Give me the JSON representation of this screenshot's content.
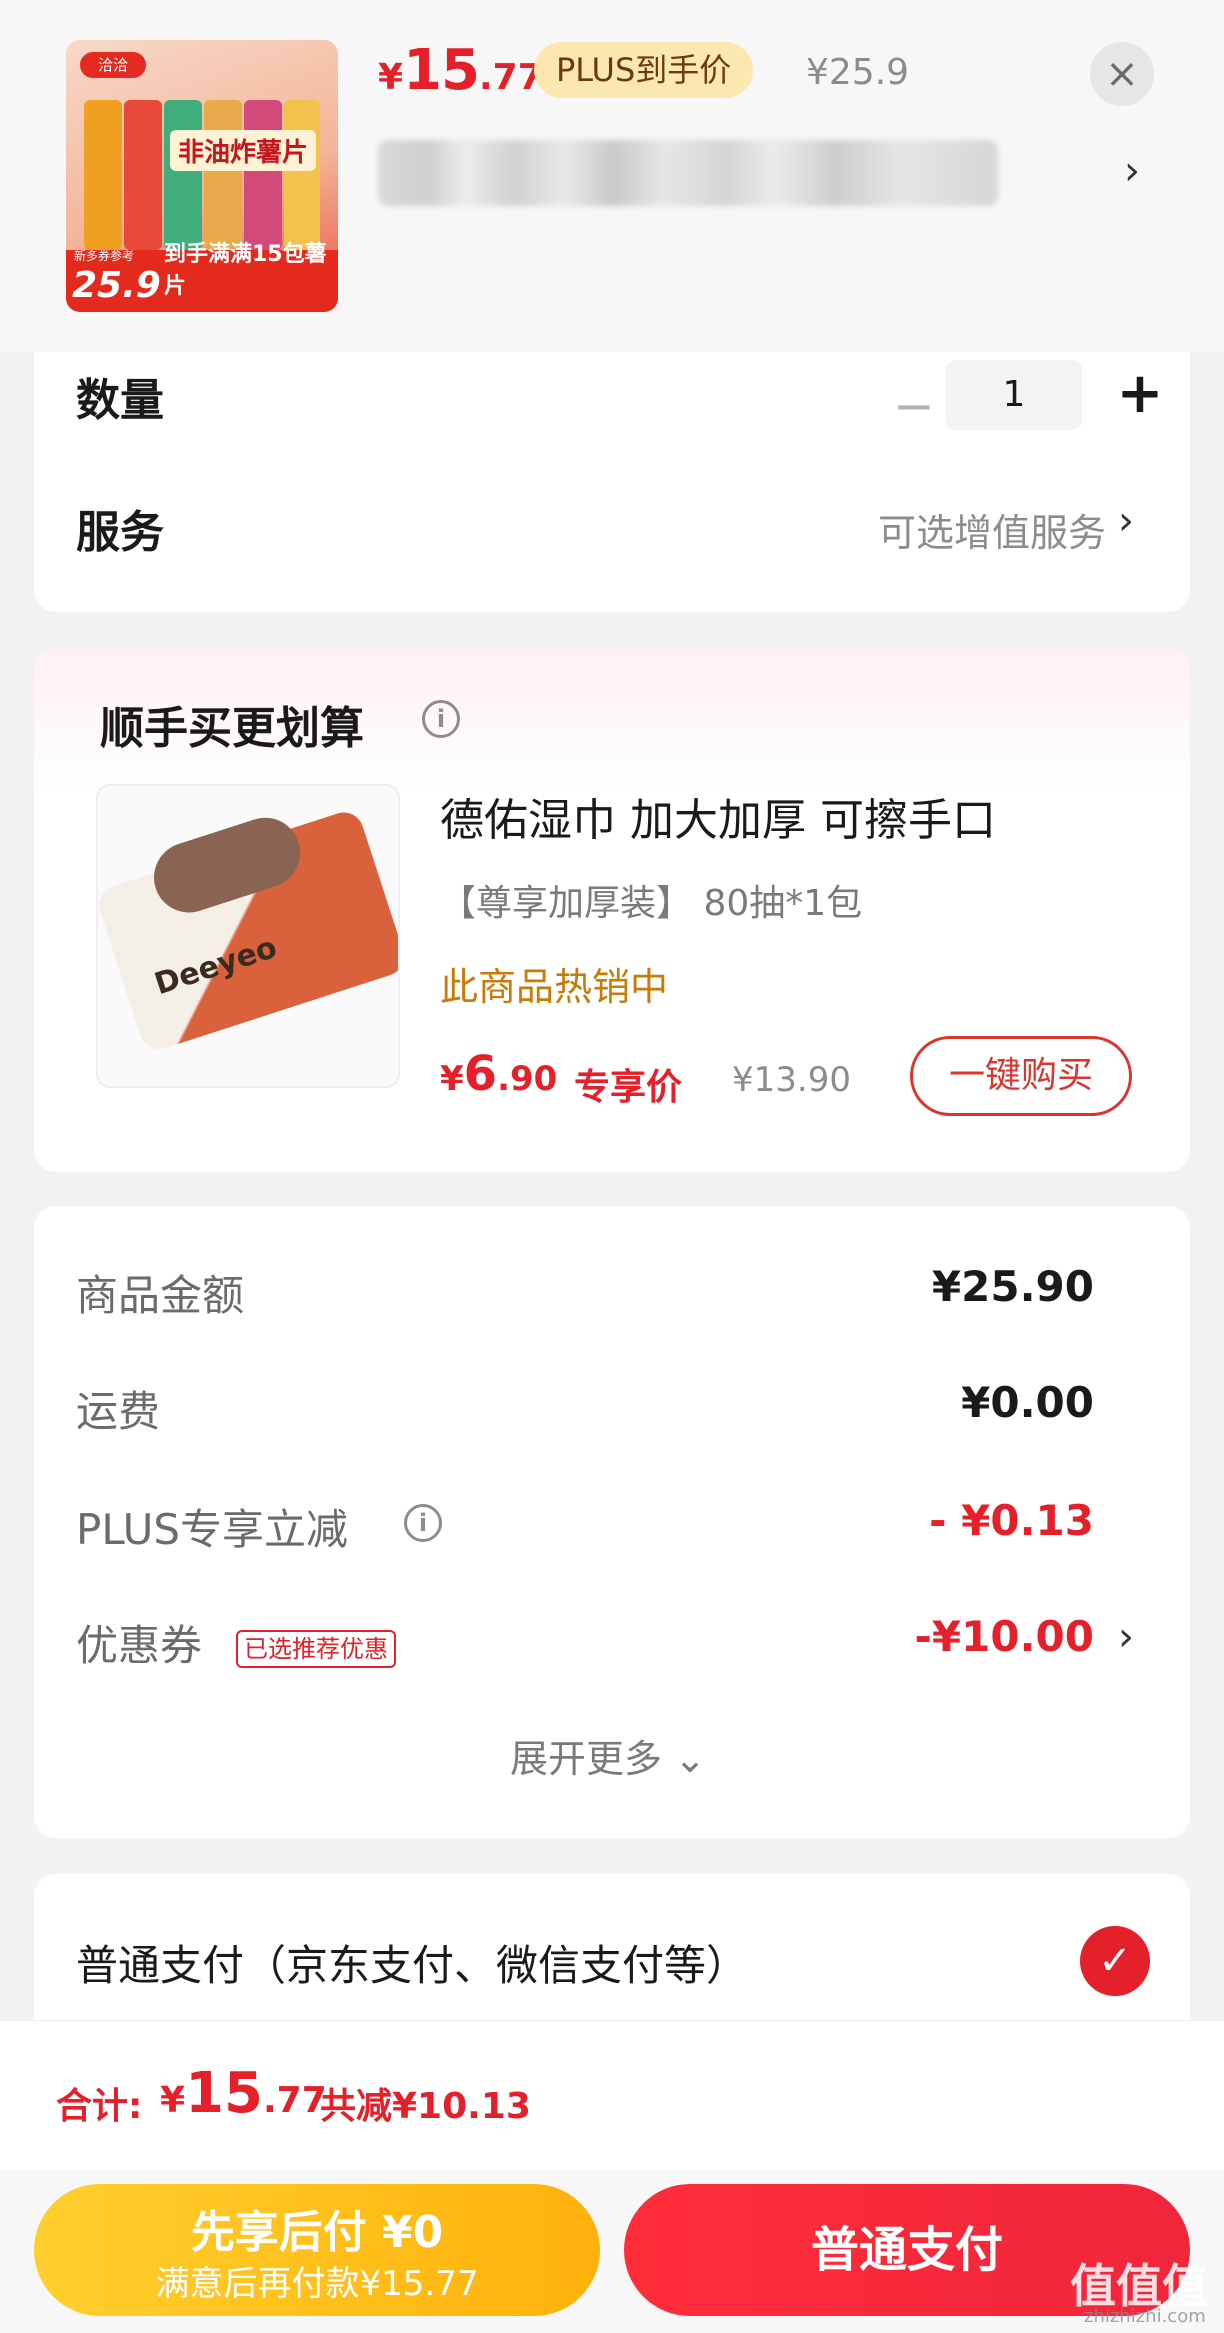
{
  "product": {
    "thumb": {
      "brand": "洽洽",
      "tag": "非油炸薯片",
      "band_price": "25.9",
      "band_text": "到手满满15包薯片",
      "band_small": "新多券参考",
      "bag_colors": [
        "#f0a020",
        "#e84a3a",
        "#3fae7a",
        "#e7a94a",
        "#d24a7a",
        "#f2c24a"
      ]
    },
    "price": {
      "symbol": "¥",
      "integer": "15",
      "decimal": ".77"
    },
    "plus_label": "PLUS到手价",
    "original_price": "¥25.9",
    "close_icon": "×",
    "title_chevron": "›"
  },
  "options": {
    "quantity_label": "数量",
    "minus": "−",
    "quantity_value": "1",
    "plus": "+",
    "service_label": "服务",
    "service_value": "可选增值服务",
    "service_chevron": "›"
  },
  "addon": {
    "section_title": "顺手买更划算",
    "info_icon": "i",
    "image_logo": "Deeyeo",
    "name": "德佑湿巾 加大加厚 可擦手口",
    "spec": "【尊享加厚装】 80抽*1包",
    "hot": "此商品热销中",
    "price": {
      "symbol": "¥",
      "integer": "6",
      "decimal": ".90"
    },
    "price_tag": "专享价",
    "original_price": "¥13.90",
    "buy_button": "一键购买"
  },
  "details": {
    "rows": [
      {
        "label": "商品金额",
        "value": "¥25.90"
      },
      {
        "label": "运费",
        "value": "¥0.00"
      },
      {
        "label": "PLUS专享立减",
        "value": "- ¥0.13"
      },
      {
        "label": "优惠券",
        "value": "-¥10.00"
      }
    ],
    "coupon_tag": "已选推荐优惠",
    "chevron": "›",
    "info_icon": "i",
    "expand_label": "展开更多",
    "expand_icon": "⌄"
  },
  "payment": {
    "method_label": "普通支付（京东支付、微信支付等）",
    "check_icon": "✓"
  },
  "summary": {
    "total_label": "合计:",
    "total": {
      "symbol": "¥",
      "integer": "15",
      "decimal": ".77"
    },
    "savings": "共减¥10.13"
  },
  "actions": {
    "later_line1": "先享后付 ¥0",
    "later_line2": "满意后再付款¥15.77",
    "pay_label": "普通支付"
  },
  "watermark": {
    "main": "值值值",
    "sub": "zhizhizhi.com"
  },
  "colors": {
    "accent_red": "#e4202b",
    "gold": "#ffb10a",
    "plus_tag_bg": "#fbe7b0"
  }
}
